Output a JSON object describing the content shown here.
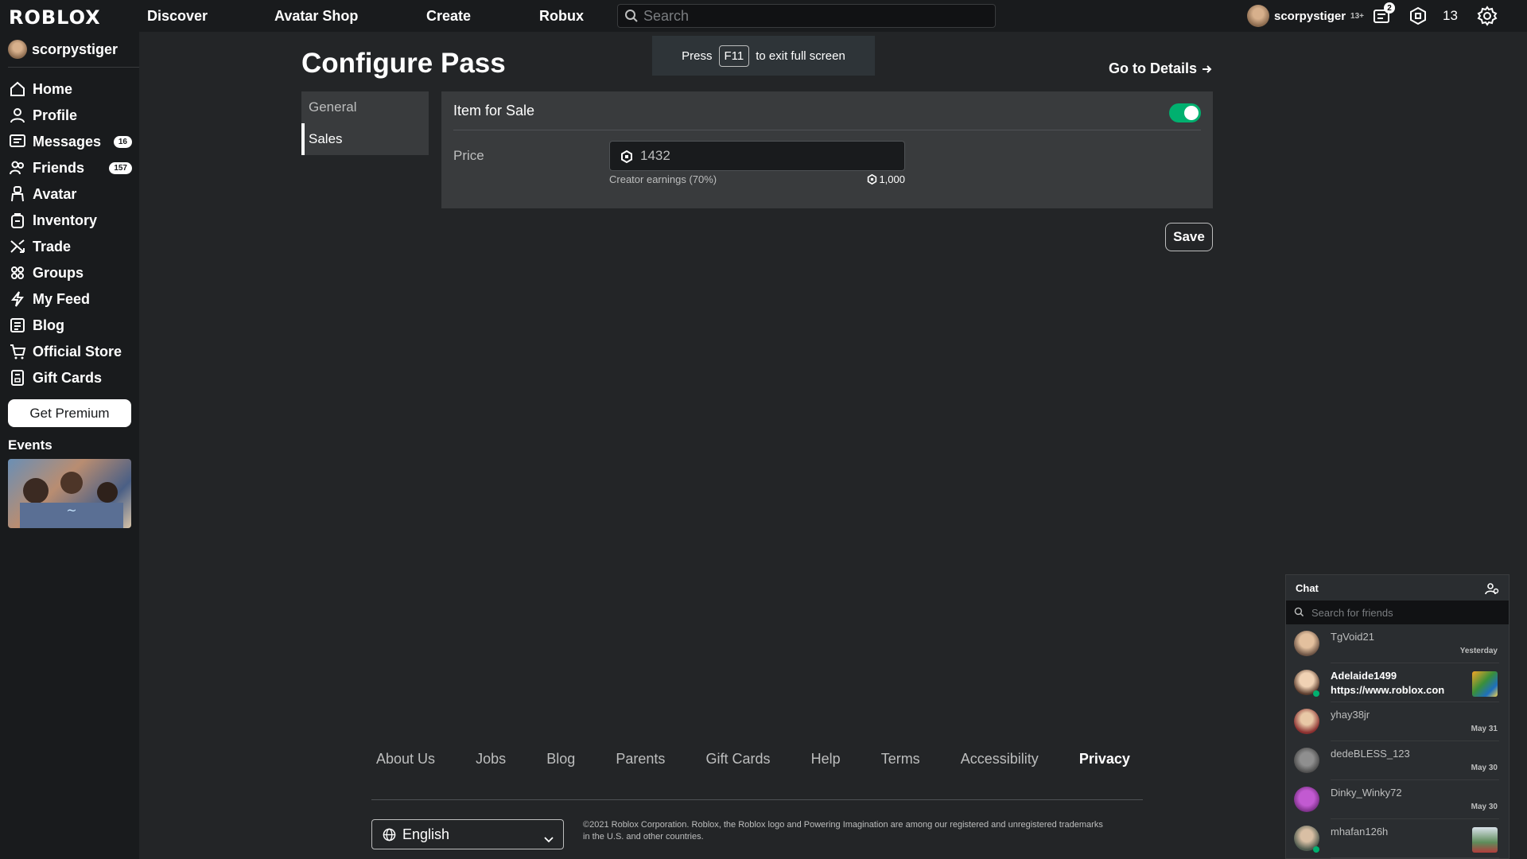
{
  "header": {
    "logo": "ROBLOX",
    "nav": [
      "Discover",
      "Avatar Shop",
      "Create",
      "Robux"
    ],
    "search_placeholder": "Search",
    "username": "scorpystiger",
    "age_tag": "13+",
    "notifications_count": "2",
    "robux_count": "13"
  },
  "sidebar": {
    "username": "scorpystiger",
    "items": [
      {
        "label": "Home",
        "icon": "home-icon"
      },
      {
        "label": "Profile",
        "icon": "profile-icon"
      },
      {
        "label": "Messages",
        "icon": "messages-icon",
        "badge": "16"
      },
      {
        "label": "Friends",
        "icon": "friends-icon",
        "badge": "157"
      },
      {
        "label": "Avatar",
        "icon": "avatar-icon"
      },
      {
        "label": "Inventory",
        "icon": "inventory-icon"
      },
      {
        "label": "Trade",
        "icon": "trade-icon"
      },
      {
        "label": "Groups",
        "icon": "groups-icon"
      },
      {
        "label": "My Feed",
        "icon": "feed-icon"
      },
      {
        "label": "Blog",
        "icon": "blog-icon"
      },
      {
        "label": "Official Store",
        "icon": "store-icon"
      },
      {
        "label": "Gift Cards",
        "icon": "gift-card-icon"
      }
    ],
    "premium_label": "Get Premium",
    "events_label": "Events"
  },
  "fullscreen_toast": {
    "before": "Press",
    "key": "F11",
    "after": "to exit full screen"
  },
  "main": {
    "title": "Configure Pass",
    "details_link": "Go to Details",
    "tabs": [
      "General",
      "Sales"
    ],
    "active_tab": "Sales",
    "item_for_sale_label": "Item for Sale",
    "item_for_sale_on": true,
    "price_label": "Price",
    "price_value": "1432",
    "earnings_label": "Creator earnings (70%)",
    "earnings_value": "1,000",
    "save_label": "Save"
  },
  "footer": {
    "links": [
      "About Us",
      "Jobs",
      "Blog",
      "Parents",
      "Gift Cards",
      "Help",
      "Terms",
      "Accessibility",
      "Privacy"
    ],
    "language": "English",
    "copyright": "©2021 Roblox Corporation. Roblox, the Roblox logo and Powering Imagination are among our registered and unregistered trademarks in the U.S. and other countries."
  },
  "chat": {
    "title": "Chat",
    "search_placeholder": "Search for friends",
    "conversations": [
      {
        "name": "TgVoid21",
        "time": "Yesterday",
        "message": "",
        "unread": false
      },
      {
        "name": "Adelaide1499",
        "time": "",
        "message": "https://www.roblox.con",
        "unread": true
      },
      {
        "name": "yhay38jr",
        "time": "May 31",
        "message": "",
        "unread": false
      },
      {
        "name": "dedeBLESS_123",
        "time": "May 30",
        "message": "",
        "unread": false
      },
      {
        "name": "Dinky_Winky72",
        "time": "May 30",
        "message": "",
        "unread": false
      },
      {
        "name": "mhafan126h",
        "time": "",
        "message": "",
        "unread": false
      }
    ]
  },
  "colors": {
    "background": "#232527",
    "topbar": "#191b1d",
    "panel": "#393b3d",
    "toggle_on": "#00b06f"
  }
}
